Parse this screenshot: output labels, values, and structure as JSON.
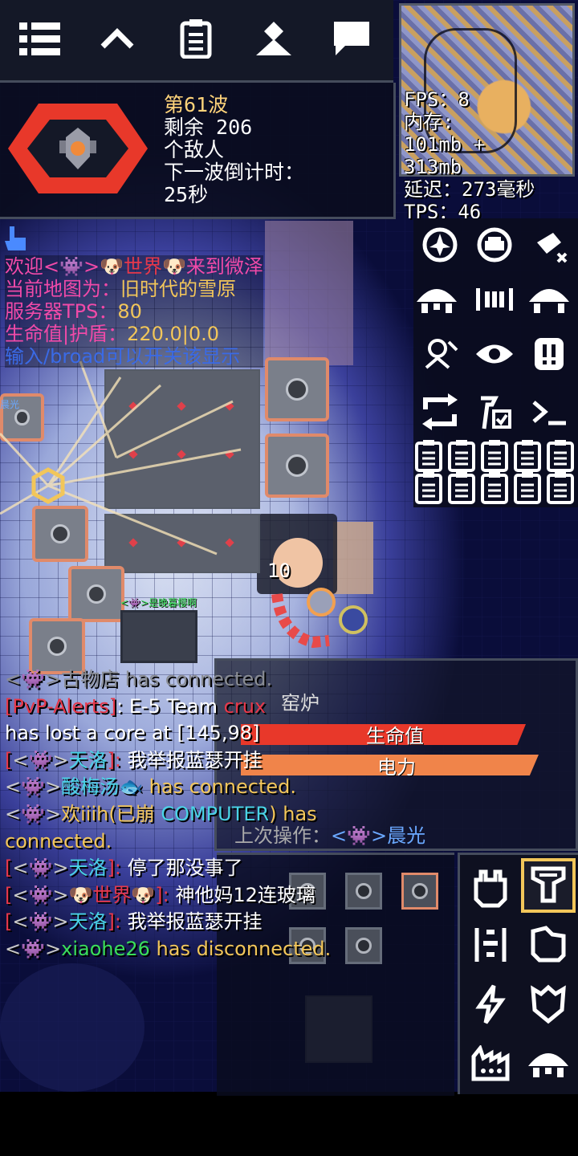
{
  "wave": {
    "title": "第61波",
    "remaining": "剩余 206",
    "enemies": "个敌人",
    "countdown_label": "下一波倒计时：",
    "countdown_value": "25秒"
  },
  "stats": {
    "fps": "FPS：8",
    "mem_label": "内存:",
    "mem1": " 101mb +",
    "mem2": " 313mb",
    "ping": "延迟：273毫秒",
    "tps": "TPS：46"
  },
  "welcome": [
    [
      {
        "t": "欢迎<",
        "c": "#f04aa8"
      },
      {
        "t": "👾",
        "c": "#cccccc"
      },
      {
        "t": ">",
        "c": "#f04aa8"
      },
      {
        "t": "🐶",
        "c": "#cccccc"
      },
      {
        "t": "世界",
        "c": "#e8384a"
      },
      {
        "t": "🐶",
        "c": "#cccccc"
      },
      {
        "t": "来到微泽",
        "c": "#f04aa8"
      }
    ],
    [
      {
        "t": "当前地图为：",
        "c": "#f04aa8"
      },
      {
        "t": "旧时代的雪原",
        "c": "#f2c65a"
      }
    ],
    [
      {
        "t": "服务器TPS：",
        "c": "#f04aa8"
      },
      {
        "t": "80",
        "c": "#f2c65a"
      }
    ],
    [
      {
        "t": "生命值|护盾：",
        "c": "#f04aa8"
      },
      {
        "t": "220.0|0.0",
        "c": "#f2c65a"
      }
    ],
    [
      {
        "t": "输入/broad可以开关该显示",
        "c": "#3a6ae6"
      }
    ]
  ],
  "world": {
    "damage_number": "10",
    "side_label": "晨光",
    "unit_tag": "<👾>是晚暮樱啊"
  },
  "info": {
    "block_name": "窑炉",
    "health_label": "生命值",
    "health": 0.92,
    "power_label": "电力",
    "power": 0.96,
    "last_action_label": "上次操作：",
    "last_action_player": "<👾>晨光"
  },
  "chat": [
    [
      {
        "t": "<👾>",
        "c": "#8a8d94"
      },
      {
        "t": "古物店",
        "c": "#8a8d94"
      },
      {
        "t": " has connected.",
        "c": "#8a8d94"
      }
    ],
    [
      {
        "t": "[PvP-Alerts]",
        "c": "#e8384a"
      },
      {
        "t": ": E-5 Team ",
        "c": "#ffffff"
      },
      {
        "t": "crux",
        "c": "#e8384a"
      }
    ],
    [
      {
        "t": "has lost a core at [145,98]",
        "c": "#ffffff"
      }
    ],
    [
      {
        "t": "[",
        "c": "#e8384a"
      },
      {
        "t": "<👾>",
        "c": "#c9c9c9"
      },
      {
        "t": "天洛",
        "c": "#4ad3e6"
      },
      {
        "t": "]: ",
        "c": "#e8384a"
      },
      {
        "t": "我举报蓝瑟开挂",
        "c": "#ffffff"
      }
    ],
    [
      {
        "t": "<👾>",
        "c": "#c9c9c9"
      },
      {
        "t": "酸梅汤",
        "c": "#4ad3e6"
      },
      {
        "t": "🐟",
        "c": "#6aa8ff"
      },
      {
        "t": " has connected.",
        "c": "#f2c65a"
      }
    ],
    [
      {
        "t": "<👾>",
        "c": "#c9c9c9"
      },
      {
        "t": "欢iiih(已崩 ",
        "c": "#f2c65a"
      },
      {
        "t": "COMPUTER",
        "c": "#4ad3e6"
      },
      {
        "t": ") has",
        "c": "#f2c65a"
      }
    ],
    [
      {
        "t": "connected.",
        "c": "#f2c65a"
      }
    ],
    [
      {
        "t": "[",
        "c": "#e8384a"
      },
      {
        "t": "<👾>",
        "c": "#c9c9c9"
      },
      {
        "t": "天洛",
        "c": "#4ad3e6"
      },
      {
        "t": "]: ",
        "c": "#e8384a"
      },
      {
        "t": "停了那没事了",
        "c": "#ffffff"
      }
    ],
    [
      {
        "t": "[",
        "c": "#e8384a"
      },
      {
        "t": "<👾>",
        "c": "#c9c9c9"
      },
      {
        "t": "🐶",
        "c": "#c9c9c9"
      },
      {
        "t": "世界",
        "c": "#e8384a"
      },
      {
        "t": "🐶",
        "c": "#c9c9c9"
      },
      {
        "t": "]: ",
        "c": "#e8384a"
      },
      {
        "t": "神他妈12连玻璃",
        "c": "#ffffff"
      }
    ],
    [
      {
        "t": "[",
        "c": "#e8384a"
      },
      {
        "t": "<👾>",
        "c": "#c9c9c9"
      },
      {
        "t": "天洛",
        "c": "#4ad3e6"
      },
      {
        "t": "]: ",
        "c": "#e8384a"
      },
      {
        "t": "我举报蓝瑟开挂",
        "c": "#ffffff"
      }
    ],
    [
      {
        "t": "<👾>",
        "c": "#c9c9c9"
      },
      {
        "t": "xiaohe26",
        "c": "#3adf5a"
      },
      {
        "t": " has disconnected.",
        "c": "#f2c65a"
      }
    ]
  ],
  "top_icons": [
    "menu-icon",
    "chevron-up-icon",
    "clipboard-icon",
    "player-icon",
    "chat-icon"
  ],
  "tool_icons": [
    "air-unit-icon",
    "ground-unit-icon",
    "lasso-icon",
    "unit-dome-icon",
    "wave-bars-icon",
    "unit-dome-icon",
    "unit-scan-icon",
    "eye-icon",
    "alert-icon",
    "refresh-icon",
    "hammer-check-icon",
    "console-icon"
  ],
  "category_icons": [
    "turret-icon",
    "distribution-icon",
    "production-icon",
    "liquid-icon",
    "power-icon",
    "defense-icon",
    "crafting-icon",
    "units-icon"
  ],
  "colors": {
    "accent": "#f2c65a",
    "health": "#e8382a",
    "power": "#f0844a",
    "panel": "#141827"
  }
}
